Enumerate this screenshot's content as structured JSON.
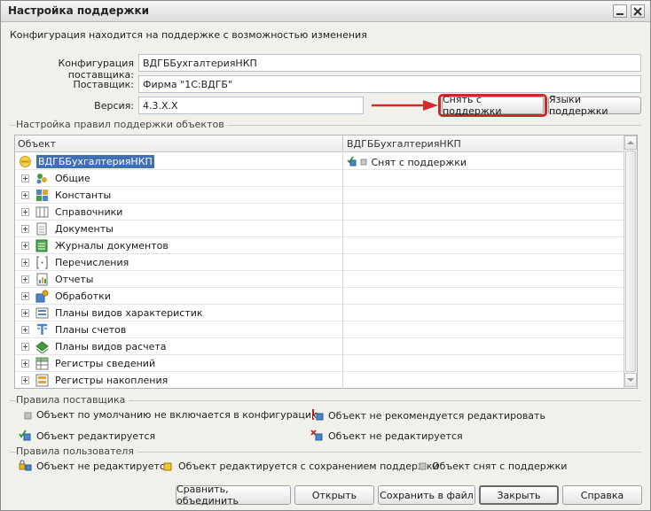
{
  "window": {
    "title": "Настройка поддержки"
  },
  "info_text": "Конфигурация находится на поддержке с возможностью изменения",
  "fields": {
    "vendor_config": {
      "label": "Конфигурация поставщика:",
      "value": "ВДГББухгалтерияНКП"
    },
    "vendor": {
      "label": "Поставщик:",
      "value": "Фирма \"1С:ВДГБ\""
    },
    "version": {
      "label": "Версия:",
      "value": "4.3.X.X"
    }
  },
  "buttons": {
    "remove_support": "Снять с поддержки",
    "support_languages": "Языки поддержки",
    "compare_merge": "Сравнить, объединить",
    "open": "Открыть",
    "save_to_file": "Сохранить в файл",
    "close": "Закрыть",
    "help": "Справка"
  },
  "rules_group": {
    "title": "Настройка правил поддержки объектов",
    "columns": {
      "object": "Объект",
      "vendor": "ВДГББухгалтерияНКП"
    },
    "root": {
      "label": "ВДГББухгалтерияНКП",
      "status": "Снят с поддержки"
    },
    "items": [
      {
        "label": "Общие",
        "icon": "common-icon"
      },
      {
        "label": "Константы",
        "icon": "constants-icon"
      },
      {
        "label": "Справочники",
        "icon": "catalogs-icon"
      },
      {
        "label": "Документы",
        "icon": "documents-icon"
      },
      {
        "label": "Журналы документов",
        "icon": "journals-icon"
      },
      {
        "label": "Перечисления",
        "icon": "enums-icon"
      },
      {
        "label": "Отчеты",
        "icon": "reports-icon"
      },
      {
        "label": "Обработки",
        "icon": "processing-icon"
      },
      {
        "label": "Планы видов характеристик",
        "icon": "char-plans-icon"
      },
      {
        "label": "Планы счетов",
        "icon": "accounts-icon"
      },
      {
        "label": "Планы видов расчета",
        "icon": "calc-plans-icon"
      },
      {
        "label": "Регистры сведений",
        "icon": "info-registers-icon"
      },
      {
        "label": "Регистры накопления",
        "icon": "accum-registers-icon"
      }
    ]
  },
  "vendor_rules": {
    "title": "Правила поставщика",
    "items": {
      "default_not_included": "Объект по умолчанию не включается в конфигурацию",
      "not_recommended": "Объект не рекомендуется редактировать",
      "editable": "Объект редактируется",
      "not_editable": "Объект не редактируется"
    }
  },
  "user_rules": {
    "title": "Правила пользователя",
    "items": {
      "not_editable": "Объект не редактируется",
      "editable_with_support": "Объект редактируется с сохранением поддержки",
      "removed": "Объект снят с поддержки"
    }
  },
  "colors": {
    "highlight": "#c92b2b",
    "selection": "#3f6fb5",
    "arrow": "#d42a2a"
  }
}
